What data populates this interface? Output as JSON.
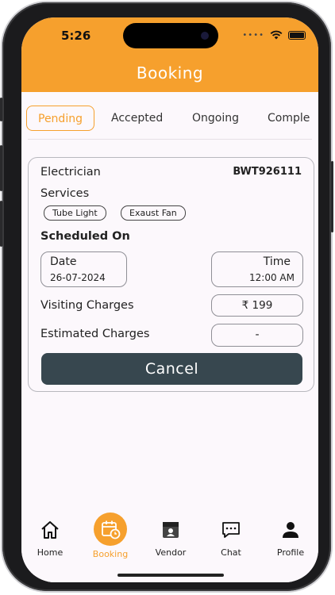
{
  "status_bar": {
    "time": "5:26",
    "dots": "•••• "
  },
  "header": {
    "title": "Booking"
  },
  "tabs": [
    {
      "label": "Pending",
      "active": true
    },
    {
      "label": "Accepted"
    },
    {
      "label": "Ongoing"
    },
    {
      "label": "Comple"
    }
  ],
  "booking": {
    "category": "Electrician",
    "booking_id": "BWT926111",
    "services_label": "Services",
    "services": [
      "Tube Light",
      "Exaust Fan"
    ],
    "scheduled_label": "Scheduled On",
    "date_label": "Date",
    "date_value": "26-07-2024",
    "time_label": "Time",
    "time_value": "12:00 AM",
    "visiting_label": "Visiting Charges",
    "visiting_value": "₹ 199",
    "estimated_label": "Estimated Charges",
    "estimated_value": "-",
    "cancel_label": "Cancel"
  },
  "bottom_nav": [
    {
      "label": "Home",
      "icon": "home-icon"
    },
    {
      "label": "Booking",
      "icon": "calendar-clock-icon",
      "active": true
    },
    {
      "label": "Vendor",
      "icon": "store-icon"
    },
    {
      "label": "Chat",
      "icon": "chat-icon"
    },
    {
      "label": "Profile",
      "icon": "person-icon"
    }
  ],
  "colors": {
    "accent": "#f6a02d",
    "button": "#37474f",
    "background": "#fcf8fc"
  }
}
